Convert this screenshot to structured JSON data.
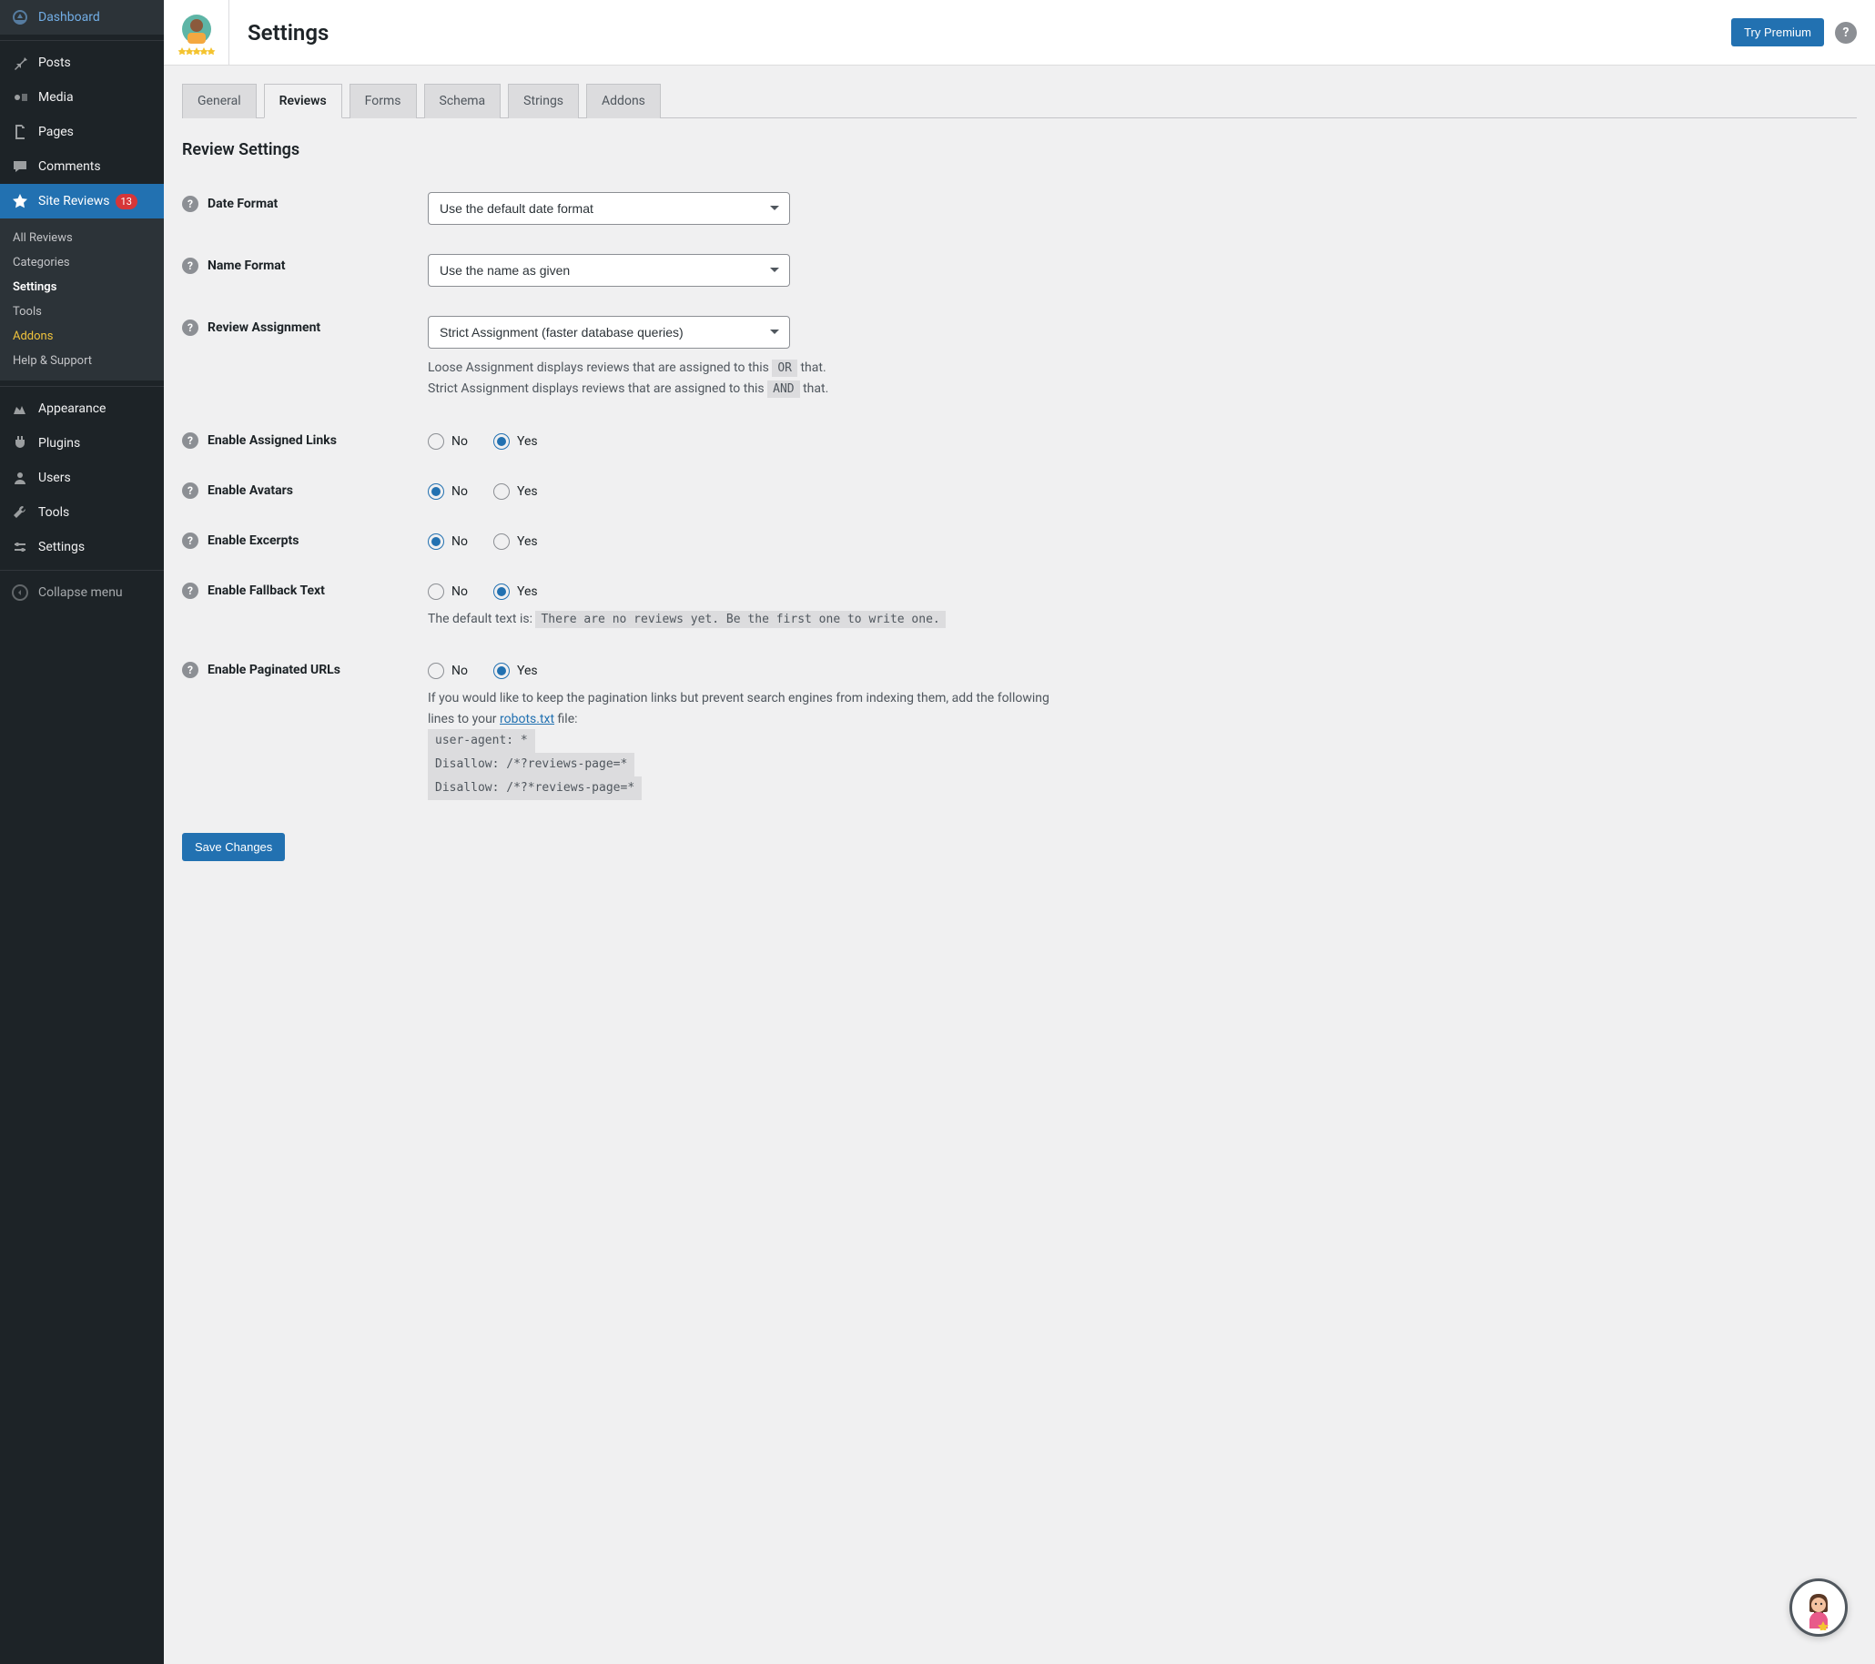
{
  "sidebar": {
    "items": [
      {
        "label": "Dashboard",
        "icon": "dashboard"
      },
      {
        "label": "Posts",
        "icon": "pin"
      },
      {
        "label": "Media",
        "icon": "media"
      },
      {
        "label": "Pages",
        "icon": "pages"
      },
      {
        "label": "Comments",
        "icon": "comments"
      },
      {
        "label": "Site Reviews",
        "icon": "star",
        "active": true,
        "badge": "13"
      },
      {
        "label": "Appearance",
        "icon": "appearance"
      },
      {
        "label": "Plugins",
        "icon": "plugins"
      },
      {
        "label": "Users",
        "icon": "users"
      },
      {
        "label": "Tools",
        "icon": "tools"
      },
      {
        "label": "Settings",
        "icon": "settings"
      }
    ],
    "submenu": [
      {
        "label": "All Reviews"
      },
      {
        "label": "Categories"
      },
      {
        "label": "Settings",
        "current": true
      },
      {
        "label": "Tools"
      },
      {
        "label": "Addons",
        "accent": true
      },
      {
        "label": "Help & Support"
      }
    ],
    "collapse": "Collapse menu"
  },
  "header": {
    "title": "Settings",
    "premium_button": "Try Premium"
  },
  "tabs": [
    {
      "label": "General"
    },
    {
      "label": "Reviews",
      "active": true
    },
    {
      "label": "Forms"
    },
    {
      "label": "Schema"
    },
    {
      "label": "Strings"
    },
    {
      "label": "Addons"
    }
  ],
  "section_title": "Review Settings",
  "settings": {
    "date_format": {
      "label": "Date Format",
      "value": "Use the default date format"
    },
    "name_format": {
      "label": "Name Format",
      "value": "Use the name as given"
    },
    "review_assignment": {
      "label": "Review Assignment",
      "value": "Strict Assignment (faster database queries)",
      "help_pre1": "Loose Assignment displays reviews that are assigned to this ",
      "help_code1": "OR",
      "help_post1": " that.",
      "help_pre2": "Strict Assignment displays reviews that are assigned to this ",
      "help_code2": "AND",
      "help_post2": " that."
    },
    "enable_assigned_links": {
      "label": "Enable Assigned Links",
      "no": "No",
      "yes": "Yes",
      "value": "yes"
    },
    "enable_avatars": {
      "label": "Enable Avatars",
      "no": "No",
      "yes": "Yes",
      "value": "no"
    },
    "enable_excerpts": {
      "label": "Enable Excerpts",
      "no": "No",
      "yes": "Yes",
      "value": "no"
    },
    "enable_fallback_text": {
      "label": "Enable Fallback Text",
      "no": "No",
      "yes": "Yes",
      "value": "yes",
      "help_pre": "The default text is: ",
      "help_code": "There are no reviews yet. Be the first one to write one."
    },
    "enable_paginated_urls": {
      "label": "Enable Paginated URLs",
      "no": "No",
      "yes": "Yes",
      "value": "yes",
      "help_pre": "If you would like to keep the pagination links but prevent search engines from indexing them, add the following lines to your ",
      "help_link": "robots.txt",
      "help_post": " file:",
      "code_l1": "user-agent: *",
      "code_l2": "Disallow: /*?reviews-page=*",
      "code_l3": "Disallow: /*?*reviews-page=*"
    }
  },
  "save_button": "Save Changes"
}
